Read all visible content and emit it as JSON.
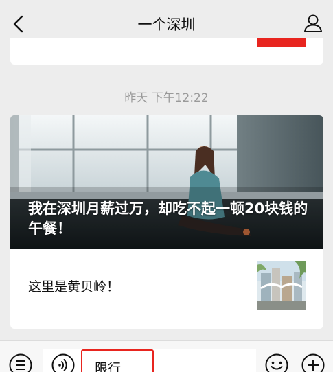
{
  "header": {
    "title": "一个深圳",
    "back_icon": "chevron-left-icon",
    "profile_icon": "user-icon"
  },
  "chat": {
    "timestamp": "昨天 下午12:22",
    "article": {
      "cover_title": "我在深圳月薪过万，却吃不起一顿20块钱的午餐！",
      "sub_title": "这里是黄贝岭！"
    }
  },
  "bottom_bar": {
    "menu_toggle_icon": "list-icon",
    "voice_icon": "voice-icon",
    "menu_item_label": "限行",
    "emoji_icon": "emoji-icon",
    "more_icon": "plus-icon"
  },
  "colors": {
    "background": "#ededed",
    "accent_red": "#e8251f",
    "timestamp_gray": "#9a9a9a"
  }
}
